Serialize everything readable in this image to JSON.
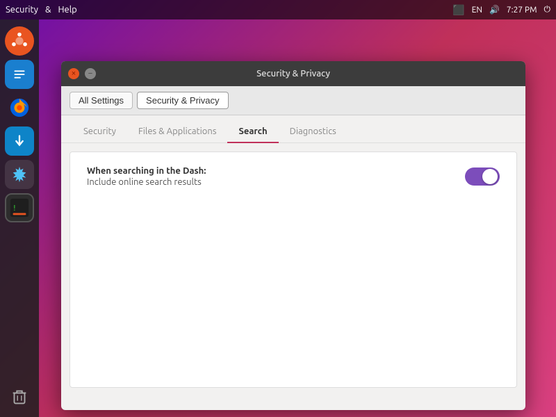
{
  "topbar": {
    "app_menu": "Security",
    "help_menu": "Help",
    "language": "EN",
    "time": "7:27 PM",
    "separator": "&"
  },
  "dock": {
    "items": [
      {
        "name": "ubuntu-logo",
        "label": "Ubuntu"
      },
      {
        "name": "files",
        "label": "Files"
      },
      {
        "name": "firefox",
        "label": "Firefox"
      },
      {
        "name": "store",
        "label": "Store"
      },
      {
        "name": "system-tools",
        "label": "System Tools"
      },
      {
        "name": "terminal",
        "label": "Terminal"
      }
    ],
    "bottom_items": [
      {
        "name": "trash",
        "label": "Trash"
      }
    ]
  },
  "window": {
    "title": "Security & Privacy",
    "close_btn": "×",
    "min_btn": "−"
  },
  "breadcrumb": {
    "all_settings_label": "All Settings",
    "current_label": "Security & Privacy"
  },
  "tabs": [
    {
      "id": "security",
      "label": "Security",
      "active": false
    },
    {
      "id": "files-apps",
      "label": "Files & Applications",
      "active": false
    },
    {
      "id": "search",
      "label": "Search",
      "active": true
    },
    {
      "id": "diagnostics",
      "label": "Diagnostics",
      "active": false
    }
  ],
  "content": {
    "section_title": "When searching in the Dash:",
    "setting_label": "Include online search results",
    "toggle_on": true
  }
}
